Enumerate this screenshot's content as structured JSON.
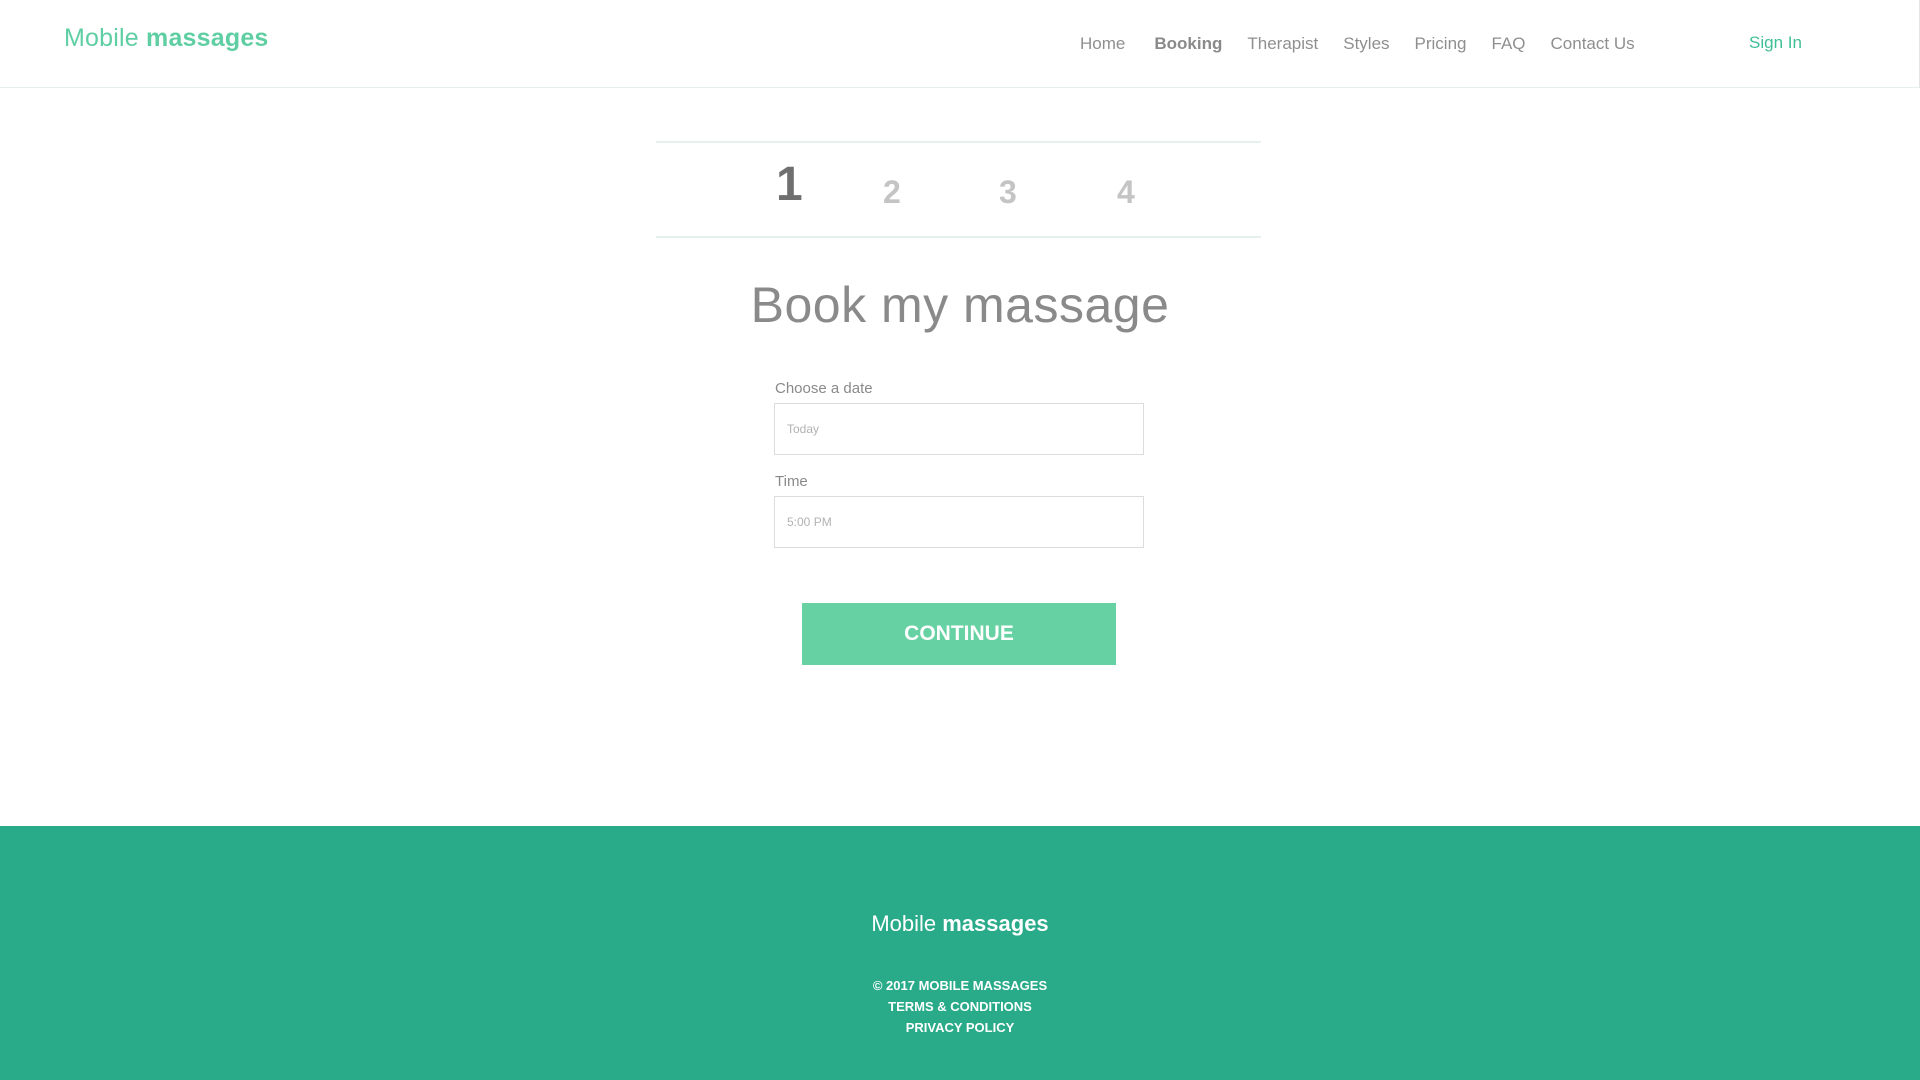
{
  "header": {
    "logo_light": "Mobile",
    "logo_bold": "massages",
    "nav": [
      {
        "label": "Home"
      },
      {
        "label": "Booking"
      },
      {
        "label": "Therapist"
      },
      {
        "label": "Styles"
      },
      {
        "label": "Pricing"
      },
      {
        "label": "FAQ"
      },
      {
        "label": "Contact Us"
      }
    ],
    "sign_in": "Sign In"
  },
  "steps": [
    {
      "label": "1"
    },
    {
      "label": "2"
    },
    {
      "label": "3"
    },
    {
      "label": "4"
    }
  ],
  "main": {
    "title": "Book my massage",
    "date_label": "Choose a date",
    "date_placeholder": "Today",
    "time_label": "Time",
    "time_placeholder": "5:00 PM",
    "continue_label": "CONTINUE"
  },
  "footer": {
    "logo_light": "Mobile",
    "logo_bold": "massages",
    "copyright": "© 2017 MOBILE MASSAGES",
    "terms": "TERMS & CONDITIONS",
    "privacy": "PRIVACY POLICY"
  },
  "colors": {
    "brand_green": "#5fcfa3",
    "button_green": "#66d1a2",
    "footer_green": "#29ab8a"
  }
}
